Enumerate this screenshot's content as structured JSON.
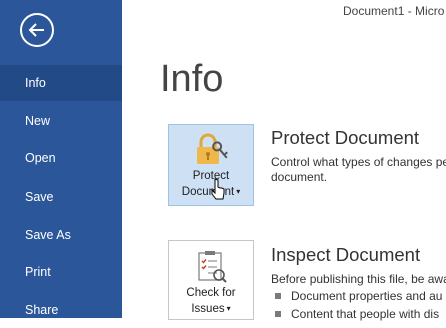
{
  "window": {
    "title": "Document1 - Micro"
  },
  "sidebar": {
    "items": [
      {
        "label": "Info",
        "active": true
      },
      {
        "label": "New"
      },
      {
        "label": "Open"
      },
      {
        "label": "Save"
      },
      {
        "label": "Save As"
      },
      {
        "label": "Print"
      },
      {
        "label": "Share"
      }
    ],
    "back_icon": "back-arrow-icon",
    "accent_color": "#2b579a"
  },
  "main": {
    "title": "Info",
    "protect": {
      "button_line1": "Protect",
      "button_line2": "Document",
      "icon": "lock-key-icon",
      "heading": "Protect Document",
      "desc_line1": "Control what types of changes pe",
      "desc_line2": "document."
    },
    "inspect": {
      "button_line1": "Check for",
      "button_line2": "Issues",
      "icon": "checklist-icon",
      "heading": "Inspect Document",
      "desc_line1": "Before publishing this file, be awa",
      "bullets": [
        "Document properties and au",
        "Content that people with dis"
      ]
    }
  }
}
